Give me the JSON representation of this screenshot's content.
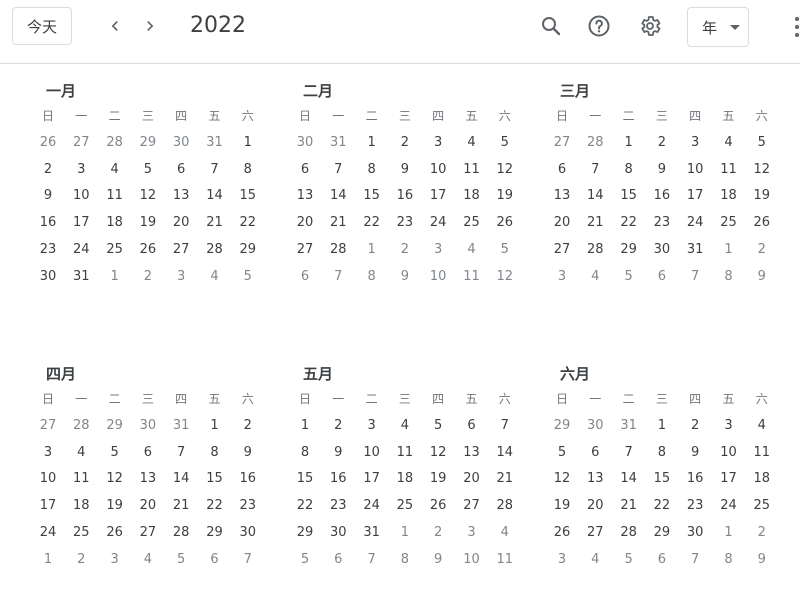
{
  "toolbar": {
    "today_label": "今天",
    "year_label": "2022",
    "view_label": "年"
  },
  "weekdays": [
    "日",
    "一",
    "二",
    "三",
    "四",
    "五",
    "六"
  ],
  "months": [
    {
      "title": "一月",
      "first_day": 6,
      "prev_days": 31,
      "days": 31
    },
    {
      "title": "二月",
      "first_day": 2,
      "prev_days": 31,
      "days": 28
    },
    {
      "title": "三月",
      "first_day": 2,
      "prev_days": 28,
      "days": 31
    },
    {
      "title": "四月",
      "first_day": 5,
      "prev_days": 31,
      "days": 30
    },
    {
      "title": "五月",
      "first_day": 0,
      "prev_days": 30,
      "days": 31
    },
    {
      "title": "六月",
      "first_day": 3,
      "prev_days": 31,
      "days": 30
    }
  ]
}
